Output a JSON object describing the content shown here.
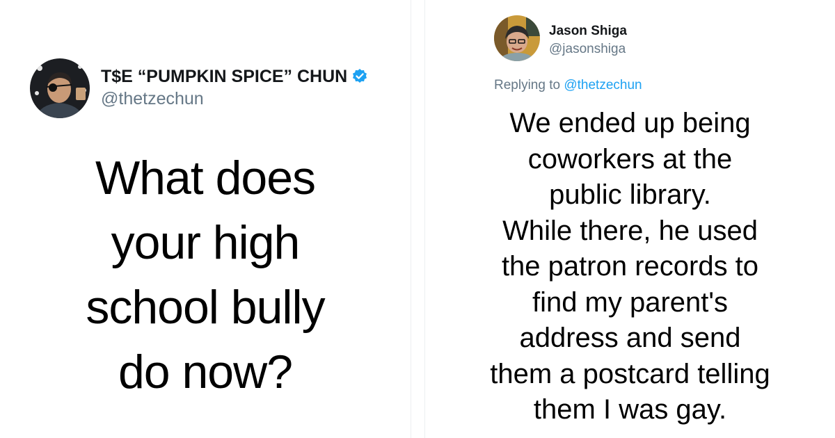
{
  "left_tweet": {
    "author": {
      "display_name": "T$E “PUMPKIN SPICE” CHUN",
      "handle": "@thetzechun",
      "verified": true,
      "avatar_icon": "user-avatar-photo"
    },
    "text_lines": [
      "What does",
      "your high",
      "school bully",
      "do now?"
    ]
  },
  "right_tweet": {
    "author": {
      "display_name": "Jason Shiga",
      "handle": "@jasonshiga",
      "avatar_icon": "user-avatar-photo"
    },
    "replying_to": {
      "prefix": "Replying to",
      "mention": "@thetzechun"
    },
    "text_lines": [
      "We ended up being",
      "coworkers at the",
      "public library.",
      "While there, he used",
      "the patron records to",
      "find my parent's",
      "address and send",
      "them a postcard telling",
      "them I was gay."
    ]
  },
  "colors": {
    "verified_badge": "#1da1f2",
    "link": "#1da1f2",
    "secondary_text": "#657786",
    "primary_text": "#14171a"
  }
}
